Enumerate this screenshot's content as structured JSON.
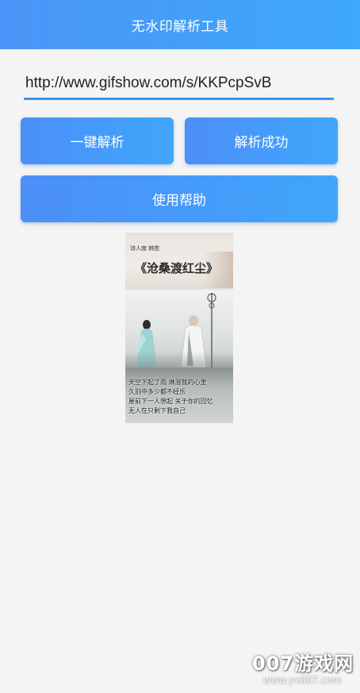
{
  "header": {
    "title": "无水印解析工具"
  },
  "url_input": {
    "value": "http://www.gifshow.com/s/KKPcpSvB"
  },
  "buttons": {
    "parse_label": "一键解析",
    "status_label": "解析成功",
    "help_label": "使用帮助"
  },
  "preview": {
    "author": "诗人寂 韩愈",
    "title": "《沧桑渡红尘》",
    "lyrics": [
      "天空下起了雨 淋湿我的心里",
      "久别中多少都不经乐",
      "屋前下一人想起 关于你的回忆",
      "无人在只剩下我自己"
    ]
  },
  "watermark": {
    "logo": "007游戏网",
    "url": "www.yx007.com"
  },
  "colors": {
    "accent": "#3a95ef",
    "header_gradient": [
      "#4a95f7",
      "#3ea8fb"
    ],
    "background": "#f4f4f4"
  }
}
